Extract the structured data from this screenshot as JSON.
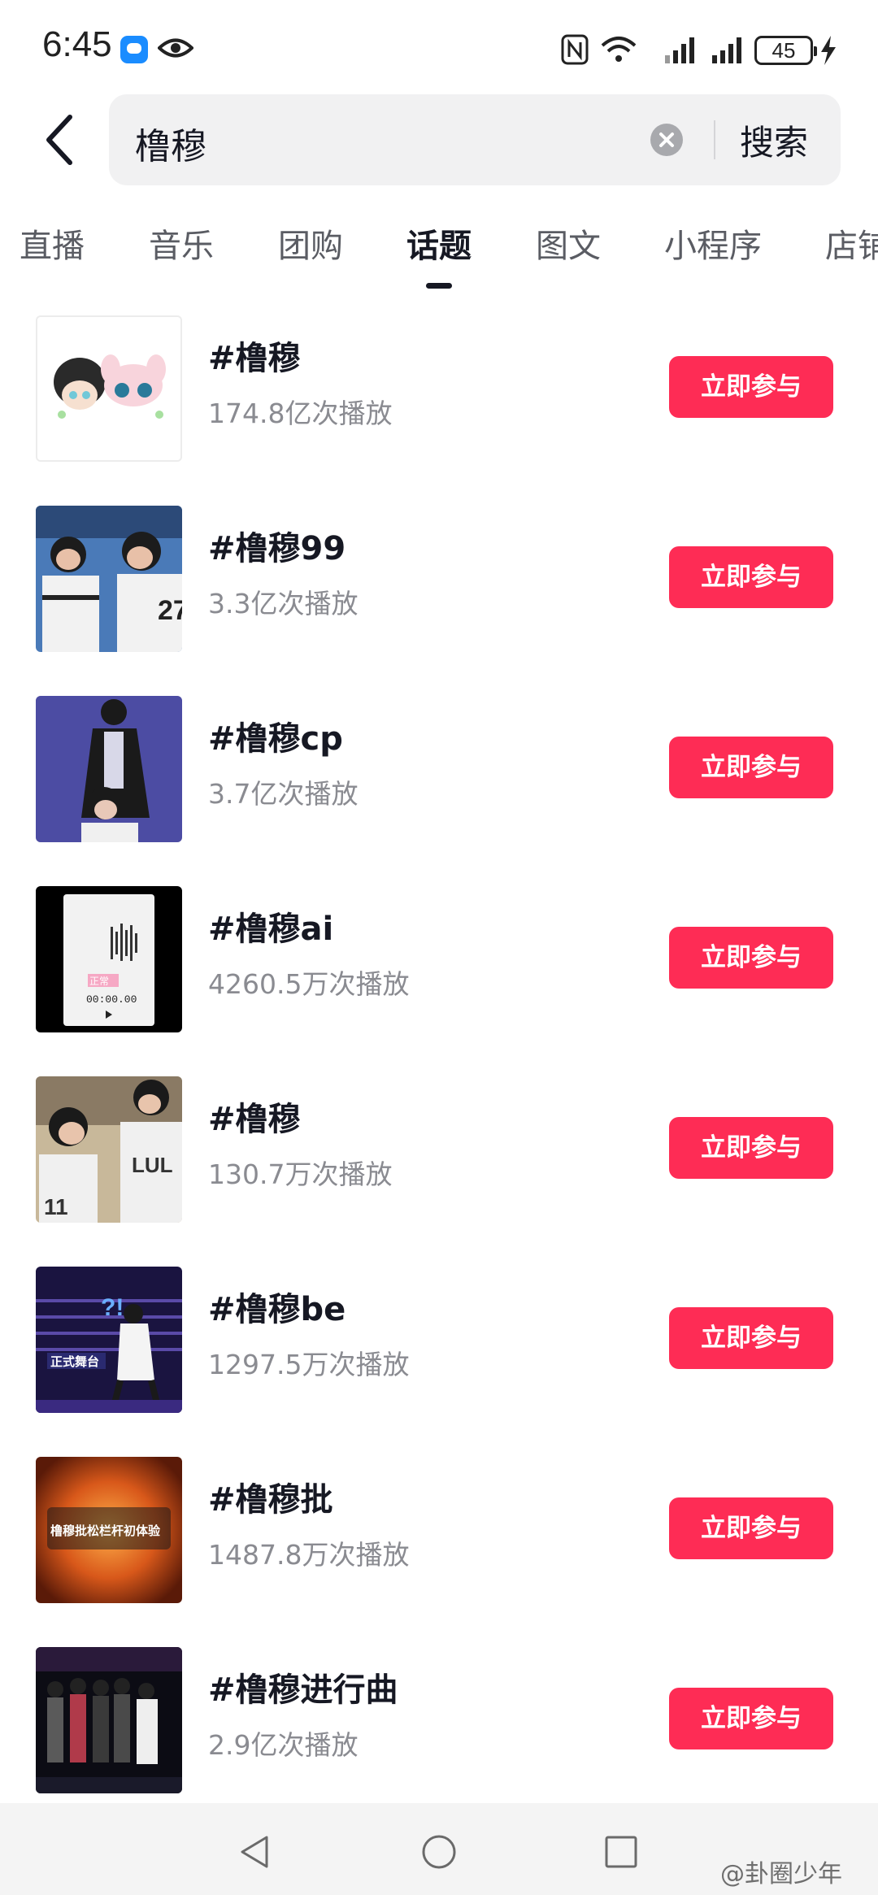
{
  "status": {
    "time": "6:45",
    "battery": "45"
  },
  "search": {
    "query": "橹穆",
    "button": "搜索"
  },
  "tabs": [
    {
      "label": "直播"
    },
    {
      "label": "音乐"
    },
    {
      "label": "团购"
    },
    {
      "label": "话题"
    },
    {
      "label": "图文"
    },
    {
      "label": "小程序"
    },
    {
      "label": "店铺"
    }
  ],
  "active_tab": "话题",
  "topics": [
    {
      "title": "#橹穆",
      "plays": "174.8亿次播放",
      "button": "立即参与"
    },
    {
      "title": "#橹穆99",
      "plays": "3.3亿次播放",
      "button": "立即参与"
    },
    {
      "title": "#橹穆cp",
      "plays": "3.7亿次播放",
      "button": "立即参与"
    },
    {
      "title": "#橹穆ai",
      "plays": "4260.5万次播放",
      "button": "立即参与",
      "thumb_text": {
        "tag": "正常",
        "timer": "00:00.00"
      }
    },
    {
      "title": "#橹穆",
      "plays": "130.7万次播放",
      "button": "立即参与"
    },
    {
      "title": "#橹穆be",
      "plays": "1297.5万次播放",
      "button": "立即参与",
      "thumb_text": {
        "caption": "正式舞台",
        "marks": "?!"
      }
    },
    {
      "title": "#橹穆批",
      "plays": "1487.8万次播放",
      "button": "立即参与",
      "thumb_text": {
        "caption": "橹穆批松栏杆初体验"
      }
    },
    {
      "title": "#橹穆进行曲",
      "plays": "2.9亿次播放",
      "button": "立即参与"
    }
  ],
  "watermark": "@卦圈少年",
  "colors": {
    "accent": "#fe2c55",
    "text_primary": "#161823",
    "text_secondary": "#8a8b91",
    "search_bg": "#f1f1f2"
  }
}
